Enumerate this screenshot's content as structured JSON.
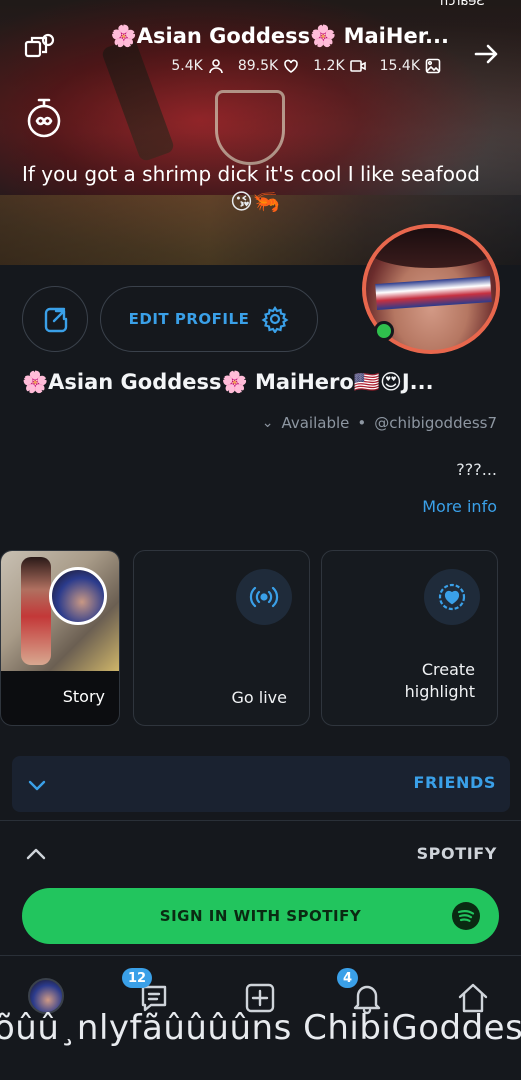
{
  "status_bar": {
    "top_text": "Search"
  },
  "header": {
    "title": "🌸Asian Goddess🌸 MaiHer...",
    "stats": {
      "photos": "15.4K",
      "videos": "1.2K",
      "likes": "89.5K",
      "fans": "5.4K"
    },
    "caption": "If you got a shrimp dick it's cool I like seafood",
    "caption_emojis": "😘🦐"
  },
  "profile": {
    "edit_label": "EDIT PROFILE",
    "display_name": "🌸Asian Goddess🌸 MaiHero🇺🇸😍J...",
    "handle": "@chibigoddess7",
    "separator": "•",
    "availability": "Available",
    "bio": "???...",
    "more_info": "More info"
  },
  "cards": {
    "highlight_label": "Create highlight",
    "live_label": "Go live",
    "story_label": "Story"
  },
  "sections": {
    "friends": "FRIENDS",
    "spotify": "SPOTIFY",
    "spotify_button": "SIGN IN WITH SPOTIFY"
  },
  "bottom_nav": {
    "messages_badge": "12",
    "notifications_badge": "4"
  },
  "footer_text": "õûû¸nlyfãûûûûns ChibiGoddes",
  "colors": {
    "accent": "#3aa0e8",
    "spotify": "#22c55e",
    "online": "#2fbf4d",
    "avatar_ring": "#e8674d"
  }
}
